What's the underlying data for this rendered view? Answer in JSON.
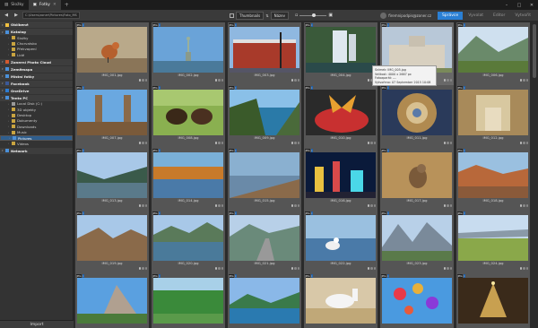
{
  "titlebar": {
    "tabs": [
      {
        "label": "Složky"
      },
      {
        "label": "Fotky"
      }
    ],
    "add_tab": "+",
    "window_controls": [
      "–",
      "□",
      "✕"
    ]
  },
  "toolbar": {
    "back": "◀",
    "forward": "▶",
    "address": "C:\\Users\\zoner\\Pictures\\Foto_MS",
    "view_mode": "Thumbnails",
    "sort": "Název",
    "user_name": "firemnipodpis@zoner.cz",
    "modes": [
      "Správce",
      "Vyvolat",
      "Editor",
      "Vytvořit"
    ]
  },
  "sidebar": {
    "items": [
      {
        "label": "Oblíbené",
        "type": "h",
        "color": "#f0c040"
      },
      {
        "label": "Katalog",
        "type": "h",
        "color": "#4a90d9"
      },
      {
        "label": "Složky",
        "type": "c",
        "color": "#c9a440"
      },
      {
        "label": "Chorvatsko",
        "type": "c",
        "color": "#c9a440"
      },
      {
        "label": "Překvapení",
        "type": "c",
        "color": "#c9a440"
      },
      {
        "label": "Lidé",
        "type": "c",
        "color": "#c9a440"
      },
      {
        "label": "Zonerní Photo Cloud",
        "type": "h",
        "color": "#d35a2f"
      },
      {
        "label": "Zeměmapa",
        "type": "h",
        "color": "#4a90d9"
      },
      {
        "label": "Místní fotky",
        "type": "h",
        "color": "#4a90d9"
      },
      {
        "label": "Facebook",
        "type": "h",
        "color": "#3b5998"
      },
      {
        "label": "OneDrive",
        "type": "h",
        "color": "#2c7cd3"
      },
      {
        "label": "Tento PC",
        "type": "h",
        "color": "#4a90d9"
      },
      {
        "label": "Local Disk (C:)",
        "type": "c",
        "color": "#999999"
      },
      {
        "label": "3D objekty",
        "type": "c",
        "color": "#c9a440"
      },
      {
        "label": "Desktop",
        "type": "c",
        "color": "#c9a440"
      },
      {
        "label": "Dokumenty",
        "type": "c",
        "color": "#c9a440"
      },
      {
        "label": "Downloads",
        "type": "c",
        "color": "#c9a440"
      },
      {
        "label": "Music",
        "type": "c",
        "color": "#c9a440"
      },
      {
        "label": "Pictures",
        "type": "s",
        "color": "#4a90d9"
      },
      {
        "label": "Videos",
        "type": "c",
        "color": "#c9a440"
      },
      {
        "label": "Network",
        "type": "h",
        "color": "#4a90d9"
      }
    ],
    "import_label": "Import"
  },
  "grid": {
    "photos": [
      {
        "file": "IMG_001.jpg",
        "scene": "bird",
        "labels": [
          "JPG"
        ]
      },
      {
        "file": "IMG_002.jpg",
        "scene": "statue",
        "labels": [
          "JPG"
        ]
      },
      {
        "file": "IMG_003.jpg",
        "scene": "building",
        "labels": [
          "JPG"
        ]
      },
      {
        "file": "IMG_004.jpg",
        "scene": "waterfall",
        "labels": [
          "JPG"
        ]
      },
      {
        "file": "IMG_005.jpg",
        "scene": "palace",
        "labels": [
          "JPG"
        ]
      },
      {
        "file": "IMG_006.jpg",
        "scene": "valley",
        "labels": [
          "JPG"
        ]
      },
      {
        "file": "IMG_007.jpg",
        "scene": "bridge",
        "labels": [
          "JPG"
        ]
      },
      {
        "file": "IMG_008.jpg",
        "scene": "bison",
        "labels": [
          "JPG"
        ]
      },
      {
        "file": "IMG_009.jpg",
        "scene": "coast",
        "labels": [
          "JPG"
        ]
      },
      {
        "file": "IMG_010.jpg",
        "scene": "butterfly",
        "labels": [
          "JPG"
        ]
      },
      {
        "file": "IMG_011.jpg",
        "scene": "dome",
        "labels": [
          "JPG"
        ]
      },
      {
        "file": "IMG_012.jpg",
        "scene": "hall",
        "labels": [
          "JPG"
        ]
      },
      {
        "file": "IMG_013.jpg",
        "scene": "gorge",
        "labels": [
          "JPG"
        ]
      },
      {
        "file": "IMG_014.jpg",
        "scene": "autumn",
        "labels": [
          "JPG"
        ]
      },
      {
        "file": "IMG_015.jpg",
        "scene": "pier",
        "labels": [
          "JPG"
        ]
      },
      {
        "file": "IMG_016.jpg",
        "scene": "vegas",
        "labels": [
          "JPG"
        ]
      },
      {
        "file": "IMG_017.jpg",
        "scene": "squirrel",
        "labels": [
          "JPG"
        ]
      },
      {
        "file": "IMG_018.jpg",
        "scene": "canyon",
        "labels": [
          "JPG"
        ]
      },
      {
        "file": "IMG_019.jpg",
        "scene": "canyon2",
        "labels": [
          "JPG"
        ]
      },
      {
        "file": "IMG_020.jpg",
        "scene": "lake",
        "labels": [
          "JPG"
        ]
      },
      {
        "file": "IMG_021.jpg",
        "scene": "road",
        "labels": [
          "JPG"
        ]
      },
      {
        "file": "IMG_022.jpg",
        "scene": "gull",
        "labels": [
          "JPG"
        ]
      },
      {
        "file": "IMG_023.jpg",
        "scene": "peaks",
        "labels": [
          "JPG"
        ]
      },
      {
        "file": "IMG_024.jpg",
        "scene": "plain",
        "labels": [
          "JPG"
        ]
      },
      {
        "file": "",
        "scene": "rock",
        "labels": [
          "JPG"
        ]
      },
      {
        "file": "",
        "scene": "forest",
        "labels": [
          "JPG"
        ]
      },
      {
        "file": "",
        "scene": "lakeside",
        "labels": [
          "JPG"
        ]
      },
      {
        "file": "",
        "scene": "horse",
        "labels": [
          "JPG"
        ]
      },
      {
        "file": "",
        "scene": "balloons",
        "labels": [
          "JPG"
        ]
      },
      {
        "file": "",
        "scene": "tree",
        "labels": [
          "JPG"
        ]
      }
    ],
    "highlight_index": 4
  },
  "tooltip": {
    "lines": [
      "Snímek: IMG_005.jpg",
      "Velikost: 4000 x 2667 px",
      "Fotoaparát: ---",
      "Vytvořeno: 07 September 2015 10:08"
    ]
  }
}
